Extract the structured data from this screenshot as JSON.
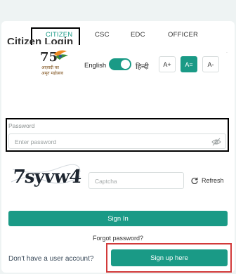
{
  "tabs": [
    {
      "label": "CITIZEN"
    },
    {
      "label": "CSC"
    },
    {
      "label": "EDC"
    },
    {
      "label": "OFFICER"
    }
  ],
  "title": "Citizen Login",
  "logo": {
    "line1": "आज़ादी का",
    "line2": "अमृत महोत्सव",
    "number": "75"
  },
  "language": {
    "english": "English",
    "hindi": "हिन्दी"
  },
  "font_size_buttons": [
    {
      "label": "A+"
    },
    {
      "label": "A="
    },
    {
      "label": "A-"
    }
  ],
  "password": {
    "label": "Password",
    "placeholder": "Enter password"
  },
  "captcha": {
    "image_text": "7syvw4",
    "placeholder": "Captcha",
    "refresh_label": "Refresh"
  },
  "signin_label": "Sign In",
  "forgot_label": "Forgot password?",
  "no_account_label": "Don't have a user account?",
  "signup_label": "Sign up here",
  "colors": {
    "accent": "#1a9a86",
    "highlight_border": "#000000",
    "signup_border": "#d23a3a"
  },
  "icons": {
    "password_toggle": "eye-slash-icon",
    "refresh": "refresh-icon"
  }
}
